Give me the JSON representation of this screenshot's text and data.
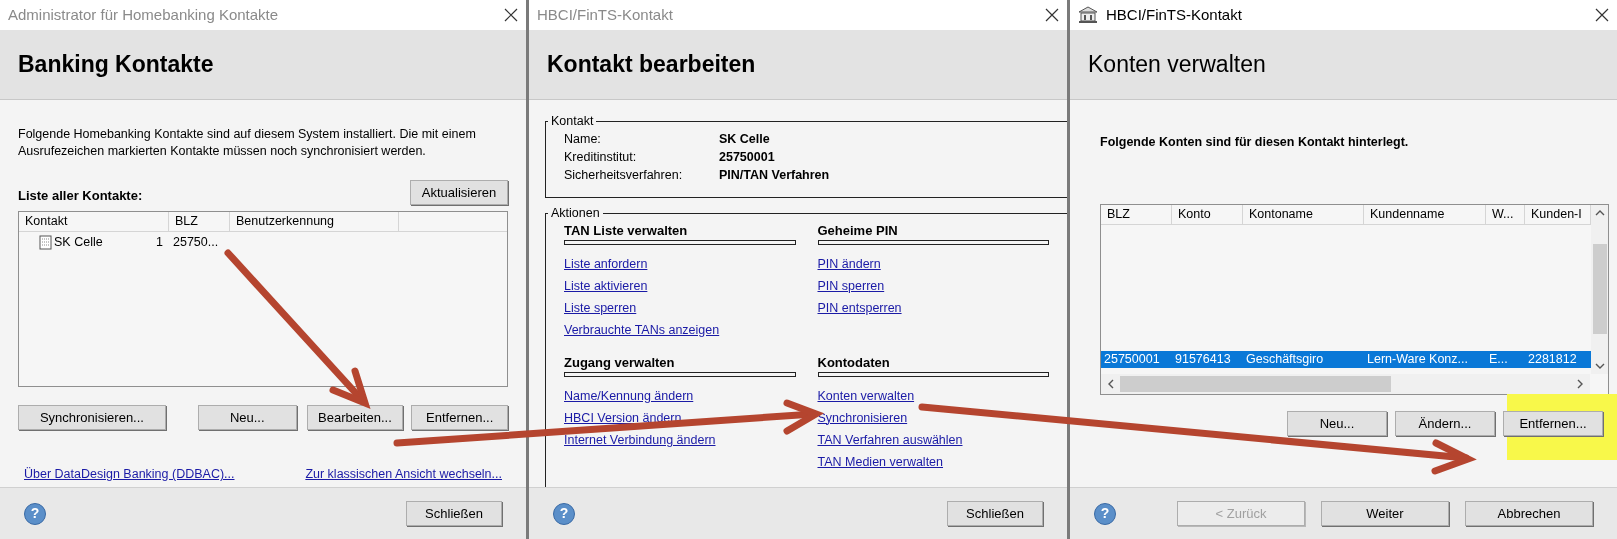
{
  "windows": [
    {
      "kind": "contacts",
      "title": "Administrator für Homebanking Kontakte",
      "heading": "Banking Kontakte",
      "description": "Folgende Homebanking Kontakte sind auf diesem System installiert. Die mit einem Ausrufezeichen markierten Kontakte müssen noch synchronisiert werden.",
      "list_label": "Liste aller Kontakte:",
      "refresh_button": "Aktualisieren",
      "table": {
        "columns": [
          "Kontakt",
          "BLZ",
          "Benutzerkennung"
        ],
        "rows": [
          {
            "name": "SK Celle",
            "count": "1",
            "blz": "25750..."
          }
        ]
      },
      "buttons": [
        "Synchronisieren...",
        "Neu...",
        "Bearbeiten...",
        "Entfernen..."
      ],
      "links": [
        "Über DataDesign Banking (DDBAC)...",
        "Zur klassischen Ansicht wechseln..."
      ],
      "help_icon": "?",
      "footer_buttons": [
        {
          "label": "Schließen",
          "disabled": false
        }
      ]
    },
    {
      "kind": "edit",
      "title": "HBCI/FinTS-Kontakt",
      "heading": "Kontakt bearbeiten",
      "contact_group": {
        "legend": "Kontakt",
        "fields": [
          {
            "label": "Name:",
            "value": "SK Celle"
          },
          {
            "label": "Kreditinstitut:",
            "value": "25750001"
          },
          {
            "label": "Sicherheitsverfahren:",
            "value": "PIN/TAN Verfahren"
          }
        ]
      },
      "actions_group": {
        "legend": "Aktionen",
        "sections": [
          {
            "heading": "TAN Liste verwalten",
            "links": [
              "Liste anfordern",
              "Liste aktivieren",
              "Liste sperren",
              "Verbrauchte TANs anzeigen"
            ]
          },
          {
            "heading": "Geheime PIN",
            "links": [
              "PIN ändern",
              "PIN sperren",
              "PIN entsperren"
            ]
          },
          {
            "heading": "Zugang verwalten",
            "links": [
              "Name/Kennung ändern",
              "HBCI Version ändern",
              "Internet Verbindung ändern"
            ]
          },
          {
            "heading": "Kontodaten",
            "links": [
              "Konten verwalten",
              "Synchronisieren",
              "TAN Verfahren auswählen",
              "TAN Medien verwalten"
            ]
          }
        ]
      },
      "help_icon": "?",
      "footer_buttons": [
        {
          "label": "Schließen",
          "disabled": false
        }
      ]
    },
    {
      "kind": "accounts",
      "title": "HBCI/FinTS-Kontakt",
      "heading": "Konten verwalten",
      "description": "Folgende Konten sind für diesen Kontakt hinterlegt.",
      "table": {
        "columns": [
          "BLZ",
          "Konto",
          "Kontoname",
          "Kundenname",
          "W...",
          "Kunden-I"
        ],
        "rows": [
          {
            "cells": [
              "25750001",
              "91576413",
              "Geschäftsgiro",
              "Lern-Ware Konz...",
              "E...",
              "2281812"
            ],
            "selected": true
          }
        ]
      },
      "buttons": [
        {
          "label": "Neu...",
          "highlighted": false
        },
        {
          "label": "Ändern...",
          "highlighted": false
        },
        {
          "label": "Entfernen...",
          "highlighted": true
        }
      ],
      "help_icon": "?",
      "footer_buttons": [
        {
          "label": "< Zurück",
          "disabled": true
        },
        {
          "label": "Weiter",
          "disabled": false
        },
        {
          "label": "Abbrechen",
          "disabled": false
        }
      ]
    }
  ]
}
